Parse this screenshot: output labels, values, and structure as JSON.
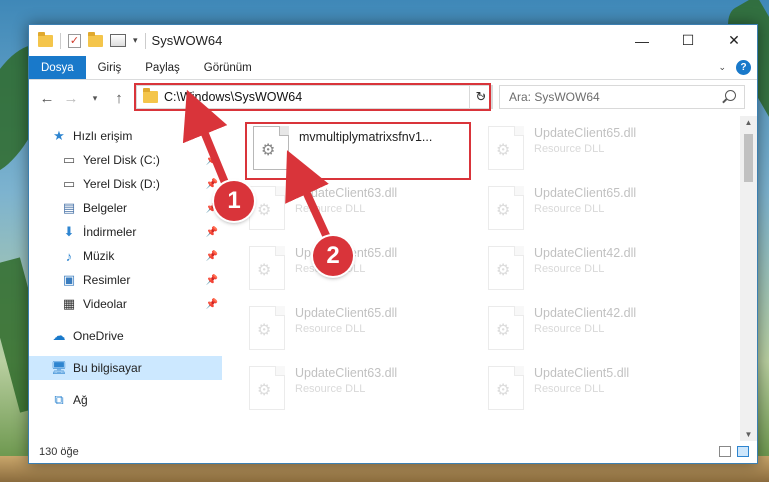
{
  "window": {
    "title": "SysWOW64",
    "controls": {
      "minimize": "—",
      "maximize": "☐",
      "close": "✕"
    }
  },
  "ribbon": {
    "tabs": [
      "Dosya",
      "Giriş",
      "Paylaş",
      "Görünüm"
    ]
  },
  "address": {
    "path": "C:\\Windows\\SysWOW64",
    "search_placeholder": "Ara: SysWOW64"
  },
  "nav": {
    "quick_access": "Hızlı erişim",
    "items": [
      {
        "label": "Yerel Disk (C:)",
        "icon": "drive-icon"
      },
      {
        "label": "Yerel Disk (D:)",
        "icon": "drive-icon"
      },
      {
        "label": "Belgeler",
        "icon": "documents-icon"
      },
      {
        "label": "İndirmeler",
        "icon": "downloads-icon"
      },
      {
        "label": "Müzik",
        "icon": "music-icon"
      },
      {
        "label": "Resimler",
        "icon": "pictures-icon"
      },
      {
        "label": "Videolar",
        "icon": "videos-icon"
      }
    ],
    "onedrive": "OneDrive",
    "this_pc": "Bu bilgisayar",
    "network": "Ağ"
  },
  "files": {
    "focused": {
      "name": "mvmultiplymatrixsfnv1...",
      "type": ""
    },
    "left_column": [
      {
        "name": "UpdateClient63.dll",
        "type": "Resource DLL"
      },
      {
        "name": "UpdateClient65.dll",
        "type": "Resource DLL"
      },
      {
        "name": "UpdateClient65.dll",
        "type": "Resource DLL"
      },
      {
        "name": "UpdateClient63.dll",
        "type": "Resource DLL"
      }
    ],
    "right_column": [
      {
        "name": "UpdateClient65.dll",
        "type": "Resource DLL"
      },
      {
        "name": "UpdateClient65.dll",
        "type": "Resource DLL"
      },
      {
        "name": "UpdateClient42.dll",
        "type": "Resource DLL"
      },
      {
        "name": "UpdateClient42.dll",
        "type": "Resource DLL"
      },
      {
        "name": "UpdateClient5.dll",
        "type": "Resource DLL"
      }
    ]
  },
  "status": {
    "item_count": "130 öğe"
  },
  "callouts": [
    "1",
    "2"
  ],
  "colors": {
    "highlight": "#d9343a",
    "accent": "#1979ca"
  }
}
